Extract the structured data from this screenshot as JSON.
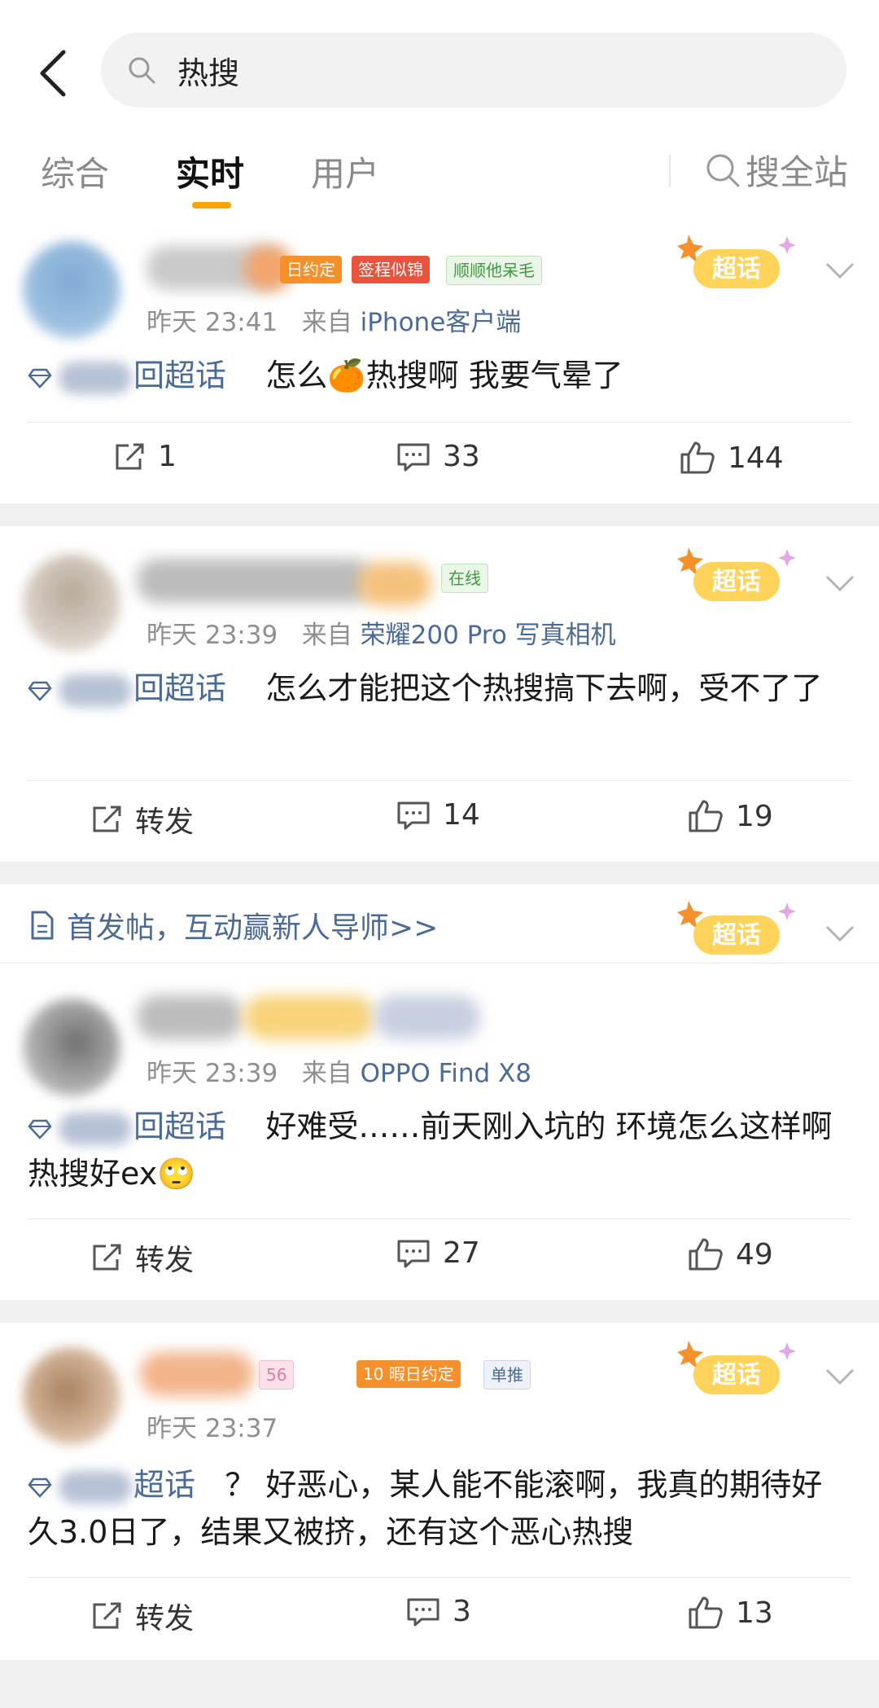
{
  "search": {
    "query": "热搜"
  },
  "tabs": [
    {
      "label": "综合"
    },
    {
      "label": "实时"
    },
    {
      "label": "用户"
    }
  ],
  "search_all_label": "搜全站",
  "posts": [
    {
      "badges": [
        "日约定",
        "签程似锦",
        "顺顺他呆毛"
      ],
      "time": "昨天 23:41",
      "source_prefix": "来自",
      "source": "iPhone客户端",
      "topic_suffix": "回超话",
      "text": "怎么🍊热搜啊 我要气晕了",
      "repost": "1",
      "comments": "33",
      "likes": "144"
    },
    {
      "badges": [
        "在线"
      ],
      "time": "昨天 23:39",
      "source_prefix": "来自",
      "source": "荣耀200 Pro 写真相机",
      "topic_suffix": "回超话",
      "text": "怎么才能把这个热搜搞下去啊，受不了了",
      "repost": "转发",
      "comments": "14",
      "likes": "19"
    },
    {
      "promo": "首发帖，互动赢新人导师>>",
      "time": "昨天 23:39",
      "source_prefix": "来自",
      "source": "OPPO Find X8",
      "topic_suffix": "回超话",
      "text": "好难受……前天刚入坑的 环境怎么这样啊 热搜好ex🙄",
      "repost": "转发",
      "comments": "27",
      "likes": "49"
    },
    {
      "badges": [
        "56",
        "10 暇日约定",
        "单推"
      ],
      "time": "昨天 23:37",
      "topic_suffix": "超话",
      "text": "？ 好恶心，某人能不能滚啊，我真的期待好久3.0日了，结果又被挤，还有这个恶心热搜",
      "repost": "转发",
      "comments": "3",
      "likes": "13"
    }
  ],
  "chaohua_badge_label": "超话",
  "colors": {
    "accent": "#f7a500",
    "link": "#4a6a98",
    "orange_badge": "#f5902b",
    "red_badge": "#e8533b",
    "green_badge": "#4db34d"
  }
}
